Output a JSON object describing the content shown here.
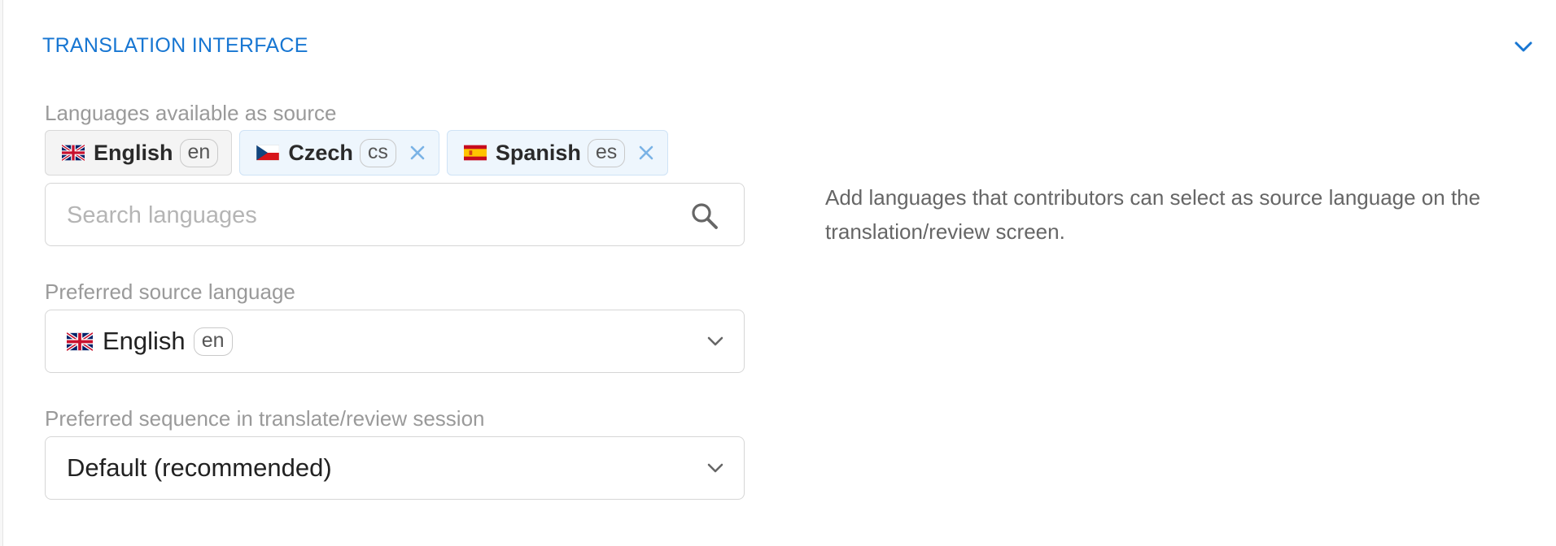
{
  "section": {
    "title": "TRANSLATION INTERFACE",
    "toggle_icon": "chevron-down-icon"
  },
  "source_languages": {
    "label": "Languages available as source",
    "chips": [
      {
        "flag": "uk-flag-icon",
        "name": "English",
        "code": "en",
        "removable": false
      },
      {
        "flag": "czech-flag-icon",
        "name": "Czech",
        "code": "cs",
        "removable": true
      },
      {
        "flag": "spain-flag-icon",
        "name": "Spanish",
        "code": "es",
        "removable": true
      }
    ],
    "search": {
      "value": "",
      "placeholder": "Search languages",
      "icon": "search-icon"
    },
    "help_text": "Add languages that contributors can select as source language on the translation/review screen."
  },
  "preferred_source": {
    "label": "Preferred source language",
    "selected_name": "English",
    "selected_code": "en",
    "selected_flag": "uk-flag-icon"
  },
  "sequence": {
    "label": "Preferred sequence in translate/review session",
    "selected": "Default (recommended)"
  },
  "colors": {
    "accent": "#1776d2",
    "label": "#9a9a9a",
    "removable_chip_bg": "#eef6fd",
    "fixed_chip_bg": "#f4f4f4"
  }
}
